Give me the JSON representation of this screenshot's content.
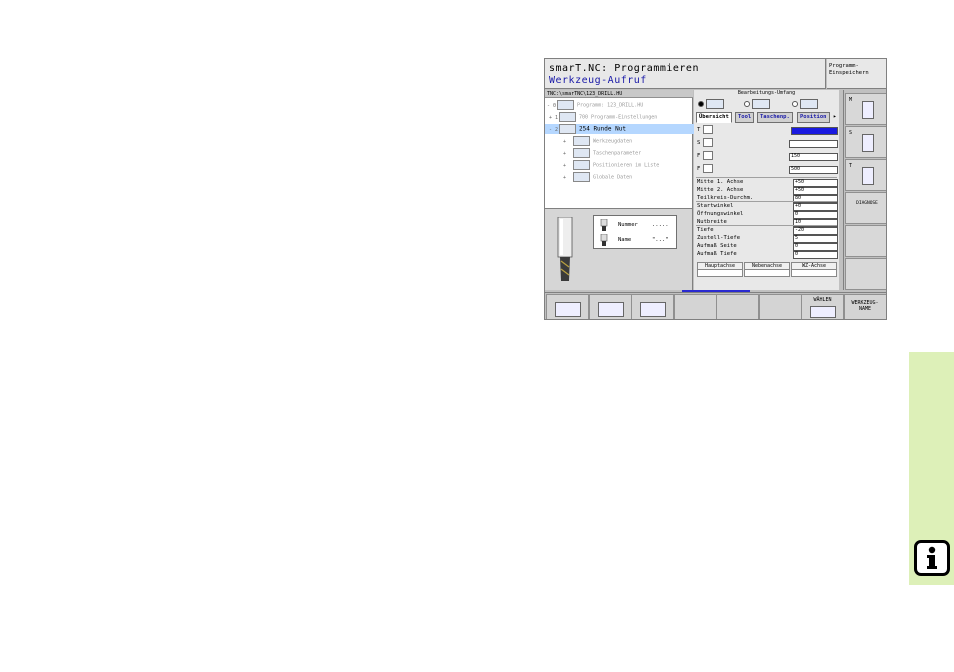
{
  "header": {
    "line1": "smarT.NC: Programmieren",
    "line2": "Werkzeug-Aufruf",
    "mode_line1": "Programm-",
    "mode_line2": "Einspeichern"
  },
  "path": "TNC:\\smarTNC\\123_DRILL.HU",
  "tree": [
    {
      "arrow": "- 0",
      "label": "Programm: 123_DRILL.HU",
      "selected": false,
      "indent": 0
    },
    {
      "arrow": "+ 1",
      "label": "700 Programm-Einstellungen",
      "selected": false,
      "indent": 1
    },
    {
      "arrow": "- 2",
      "label": "254 Runde Nut",
      "selected": true,
      "indent": 1
    },
    {
      "arrow": "+",
      "label": "Werkzeugdaten",
      "selected": false,
      "indent": 2
    },
    {
      "arrow": "+",
      "label": "Taschenparameter",
      "selected": false,
      "indent": 2
    },
    {
      "arrow": "+",
      "label": "Positionieren im Liste",
      "selected": false,
      "indent": 2
    },
    {
      "arrow": "+",
      "label": "Globale Daten",
      "selected": false,
      "indent": 2
    }
  ],
  "preview": {
    "nummer_label": "Nummer",
    "nummer_value": ".....",
    "name_label": "Name",
    "name_value": "\"...\""
  },
  "form": {
    "title": "Bearbeitungs-Umfang",
    "tabs": [
      "Übersicht",
      "Tool",
      "Taschenp.",
      "Position"
    ],
    "active_tab": 0,
    "tool_rows": [
      {
        "label": "T",
        "value": "",
        "style": "blue"
      },
      {
        "label": "S",
        "value": "",
        "style": "plain"
      },
      {
        "label": "F",
        "value": "150",
        "style": "plain"
      },
      {
        "label": "F",
        "value": "500",
        "style": "plain"
      }
    ],
    "params": [
      {
        "label": "Mitte 1. Achse",
        "value": "+50"
      },
      {
        "label": "Mitte 2. Achse",
        "value": "+50"
      },
      {
        "label": "Teilkreis-Durchm.",
        "value": "80"
      },
      {
        "label": "Startwinkel",
        "value": "+0"
      },
      {
        "label": "Öffnungswinkel",
        "value": "0"
      },
      {
        "label": "Nutbreite",
        "value": "10"
      },
      {
        "label": "Tiefe",
        "value": "-20"
      },
      {
        "label": "Zustell-Tiefe",
        "value": "5"
      },
      {
        "label": "Aufmaß Seite",
        "value": "0"
      },
      {
        "label": "Aufmaß Tiefe",
        "value": "0"
      }
    ],
    "axes": [
      "Hauptachse",
      "Nebenachse",
      "WZ-Achse"
    ]
  },
  "side_softkeys": [
    {
      "key": "M",
      "label": ""
    },
    {
      "key": "S",
      "label": ""
    },
    {
      "key": "T",
      "label": ""
    },
    {
      "key": "",
      "label": "DIAGNOSE"
    },
    {
      "key": "",
      "label": ""
    },
    {
      "key": "",
      "label": ""
    }
  ],
  "bottom_softkeys": [
    {
      "label": ""
    },
    {
      "label": ""
    },
    {
      "label": ""
    },
    {
      "label": ""
    },
    {
      "label": ""
    },
    {
      "label": ""
    },
    {
      "label": "WÄHLEN"
    },
    {
      "label": "WERKZEUG-\nNAME"
    }
  ],
  "colors": {
    "accent_blue": "#1a1ae0",
    "selection": "#b5d7ff",
    "side_tab": "#ddf0b8"
  },
  "icons": {
    "info": "info-icon"
  }
}
